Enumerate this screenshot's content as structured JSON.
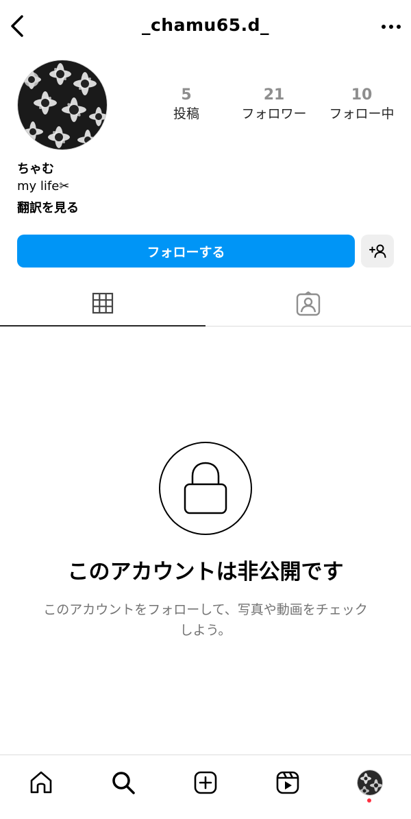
{
  "header": {
    "username": "_chamu65.d_",
    "back_icon": "chevron-left-icon",
    "more_icon": "more-horizontal-icon"
  },
  "profile": {
    "stats": [
      {
        "value": "5",
        "label": "投稿"
      },
      {
        "value": "21",
        "label": "フォロワー"
      },
      {
        "value": "10",
        "label": "フォロー中"
      }
    ],
    "name": "ちゃむ",
    "bio": "my life✂︎",
    "translate_label": "翻訳を見る"
  },
  "actions": {
    "follow_label": "フォローする",
    "suggest_icon": "add-person-icon",
    "follow_color": "#0095f6"
  },
  "tabs": {
    "grid_icon": "grid-icon",
    "tagged_icon": "tagged-person-icon"
  },
  "private": {
    "title": "このアカウントは非公開です",
    "subtitle": "このアカウントをフォローして、写真や動画をチェックしよう。"
  },
  "bottom_nav": {
    "items": [
      "home-icon",
      "search-icon",
      "create-icon",
      "reels-icon",
      "profile-avatar"
    ],
    "notification_dot_color": "#ff3040"
  }
}
